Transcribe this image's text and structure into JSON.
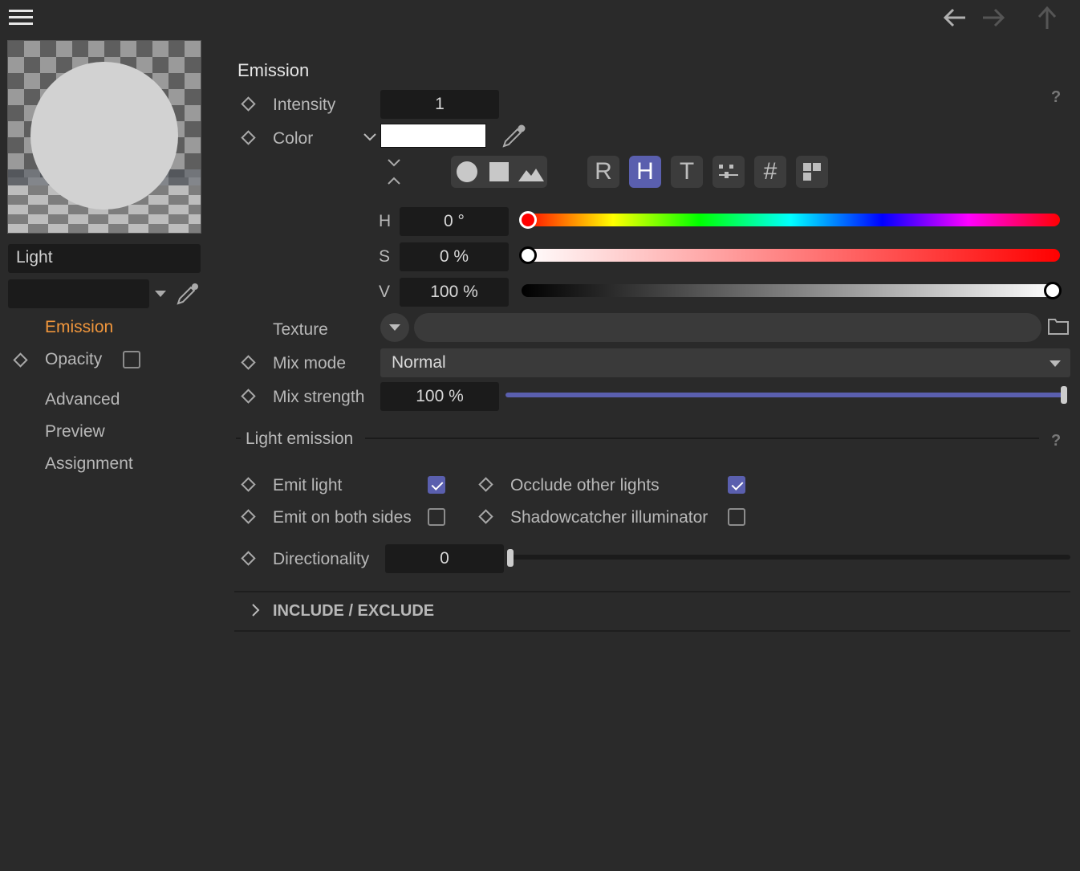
{
  "topbar": {
    "menu_icon": "hamburger-icon",
    "back_icon": "arrow-left-icon",
    "forward_icon": "arrow-right-icon",
    "up_icon": "arrow-up-icon"
  },
  "sidebar": {
    "material_name": "Light",
    "nav": [
      {
        "label": "Emission",
        "active": true
      },
      {
        "label": "Opacity"
      },
      {
        "label": "Advanced"
      },
      {
        "label": "Preview"
      },
      {
        "label": "Assignment"
      }
    ],
    "accent": "#f0963c"
  },
  "emission": {
    "title": "Emission",
    "intensity_label": "Intensity",
    "intensity_value": "1",
    "color_label": "Color",
    "color_value": "#ffffff",
    "mode_buttons": [
      "R",
      "H",
      "T",
      "#"
    ],
    "h_label": "H",
    "h_value": "0 °",
    "h_level": 0,
    "s_label": "S",
    "s_value": "0 %",
    "s_level": 0,
    "v_label": "V",
    "v_value": "100 %",
    "v_level": 1,
    "texture_label": "Texture",
    "mix_mode_label": "Mix mode",
    "mix_mode_value": "Normal",
    "mix_strength_label": "Mix strength",
    "mix_strength_value": "100 %",
    "mix_strength_level": 1
  },
  "light_emission": {
    "title": "Light emission",
    "emit_light_label": "Emit light",
    "emit_light_checked": true,
    "occlude_label": "Occlude other lights",
    "occlude_checked": true,
    "both_sides_label": "Emit on both sides",
    "both_sides_checked": false,
    "shadowcatcher_label": "Shadowcatcher illuminator",
    "shadowcatcher_checked": false,
    "directionality_label": "Directionality",
    "directionality_value": "0",
    "directionality_level": 0
  },
  "include_exclude": {
    "title": "INCLUDE / EXCLUDE"
  },
  "help_mark": "?",
  "accent_color": "#5a5fae"
}
